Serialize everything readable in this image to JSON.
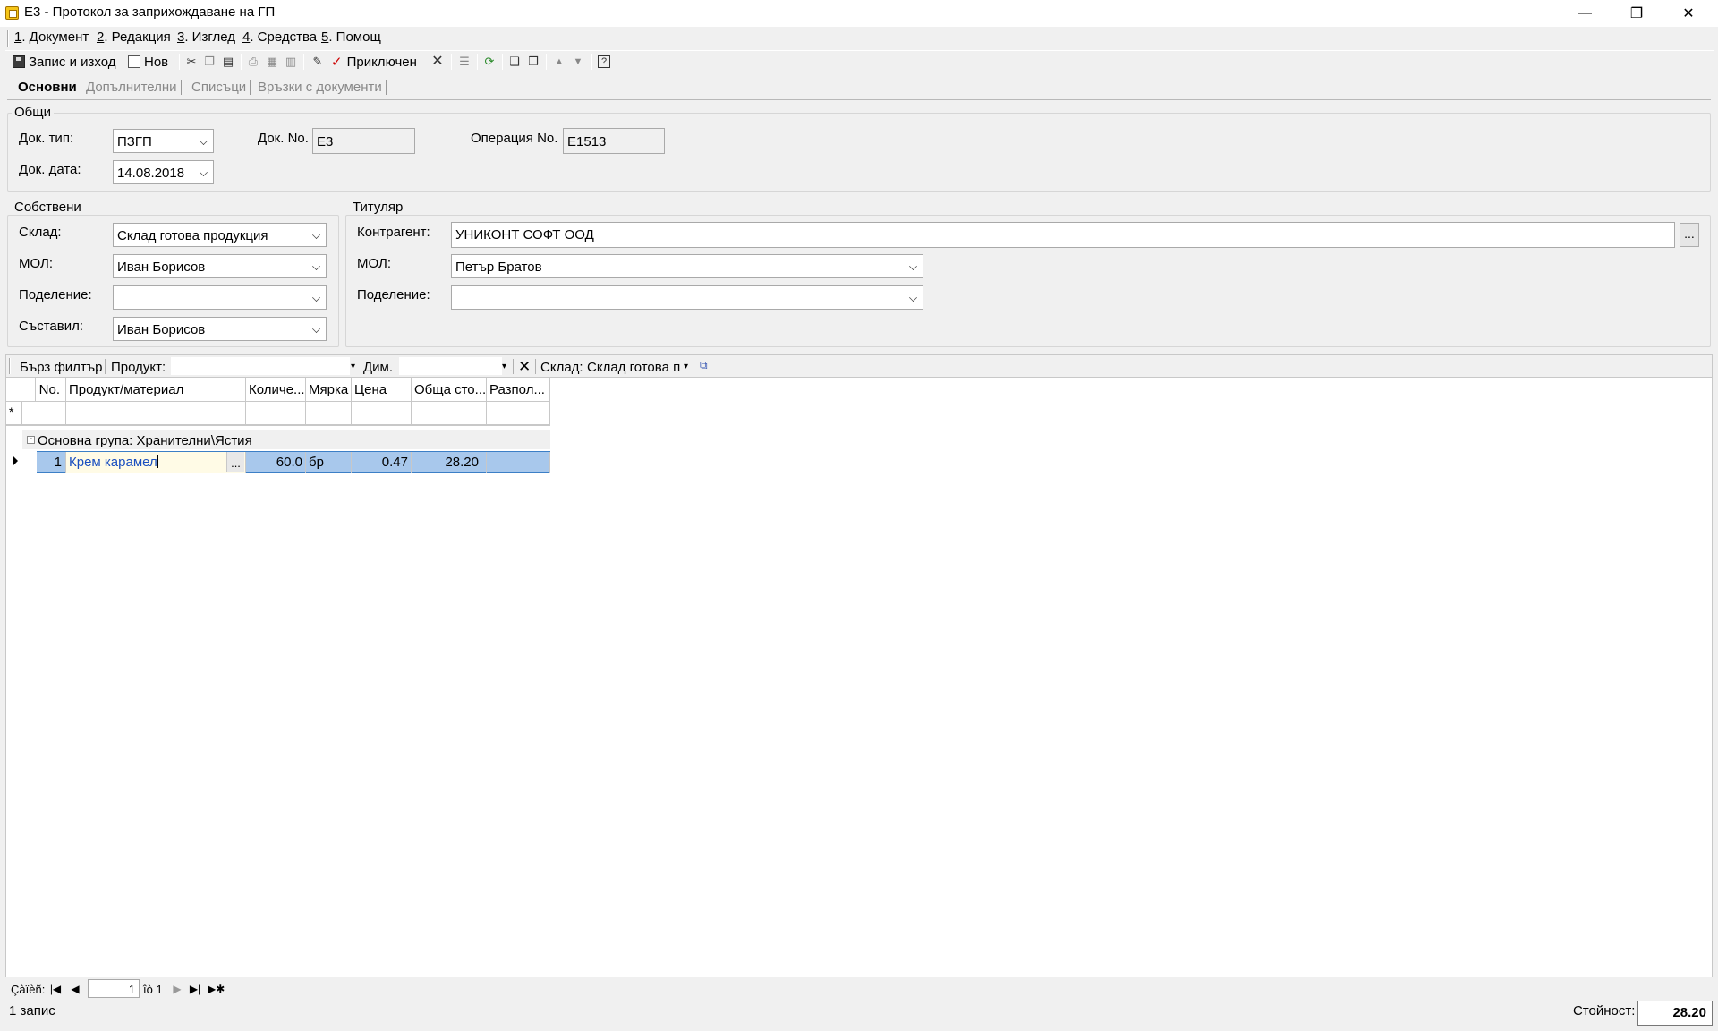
{
  "window": {
    "title": "Е3 - Протокол за заприхождаване на ГП",
    "minimize": "—",
    "restore": "❐",
    "close": "✕"
  },
  "menu": [
    {
      "num": "1",
      "label": ". Документ"
    },
    {
      "num": "2",
      "label": ". Редакция"
    },
    {
      "num": "3",
      "label": ". Изглед"
    },
    {
      "num": "4",
      "label": ". Средства"
    },
    {
      "num": "5",
      "label": ". Помощ"
    }
  ],
  "toolbar": {
    "save_exit": "Запис и изход",
    "new": "Нов",
    "closed": "Приключен"
  },
  "tabs": [
    "Основни",
    "Допълнителни",
    "Списъци",
    "Връзки с документи"
  ],
  "general": {
    "legend": "Общи",
    "doc_type_label": "Док. тип:",
    "doc_type_value": "ПЗГП",
    "doc_no_label": "Док. No.",
    "doc_no_value": "Е3",
    "op_no_label": "Операция No.",
    "op_no_value": "Е1513",
    "doc_date_label": "Док. дата:",
    "doc_date_value": "14.08.2018"
  },
  "own": {
    "legend": "Собствени",
    "warehouse_label": "Склад:",
    "warehouse_value": "Склад готова продукция",
    "mol_label": "МОЛ:",
    "mol_value": "Иван Борисов",
    "division_label": "Поделение:",
    "division_value": "",
    "author_label": "Съставил:",
    "author_value": "Иван Борисов"
  },
  "holder": {
    "legend": "Титуляр",
    "contractor_label": "Контрагент:",
    "contractor_value": "УНИКОНТ СОФТ ООД",
    "ellipsis": "...",
    "mol_label": "МОЛ:",
    "mol_value": "Петър Братов",
    "division_label": "Поделение:",
    "division_value": ""
  },
  "filter": {
    "quick": "Бърз филтър",
    "product_label": "Продукт:",
    "dim_label": "Дим.",
    "clear": "✕",
    "warehouse_label": "Склад:",
    "warehouse_value": "Склад готова пр"
  },
  "grid": {
    "columns": [
      "No.",
      "Продукт/материал",
      "Количе...",
      "Мярка",
      "Цена",
      "Обща сто...",
      "Разпол..."
    ],
    "new_row_marker": "*",
    "group_label": "Основна група: Хранителни\\Ястия",
    "group_toggle": "-",
    "rows": [
      {
        "no": "1",
        "product": "Крем карамел",
        "ellipsis": "...",
        "qty": "60.0",
        "unit": "бр",
        "price": "0.47",
        "total": "28.20",
        "avail": ""
      }
    ]
  },
  "navigator": {
    "label": "Çàïèñ:",
    "current": "1",
    "of": "îò 1"
  },
  "status": {
    "records": "1 запис",
    "value_label": "Стойност:",
    "value": "28.20"
  }
}
